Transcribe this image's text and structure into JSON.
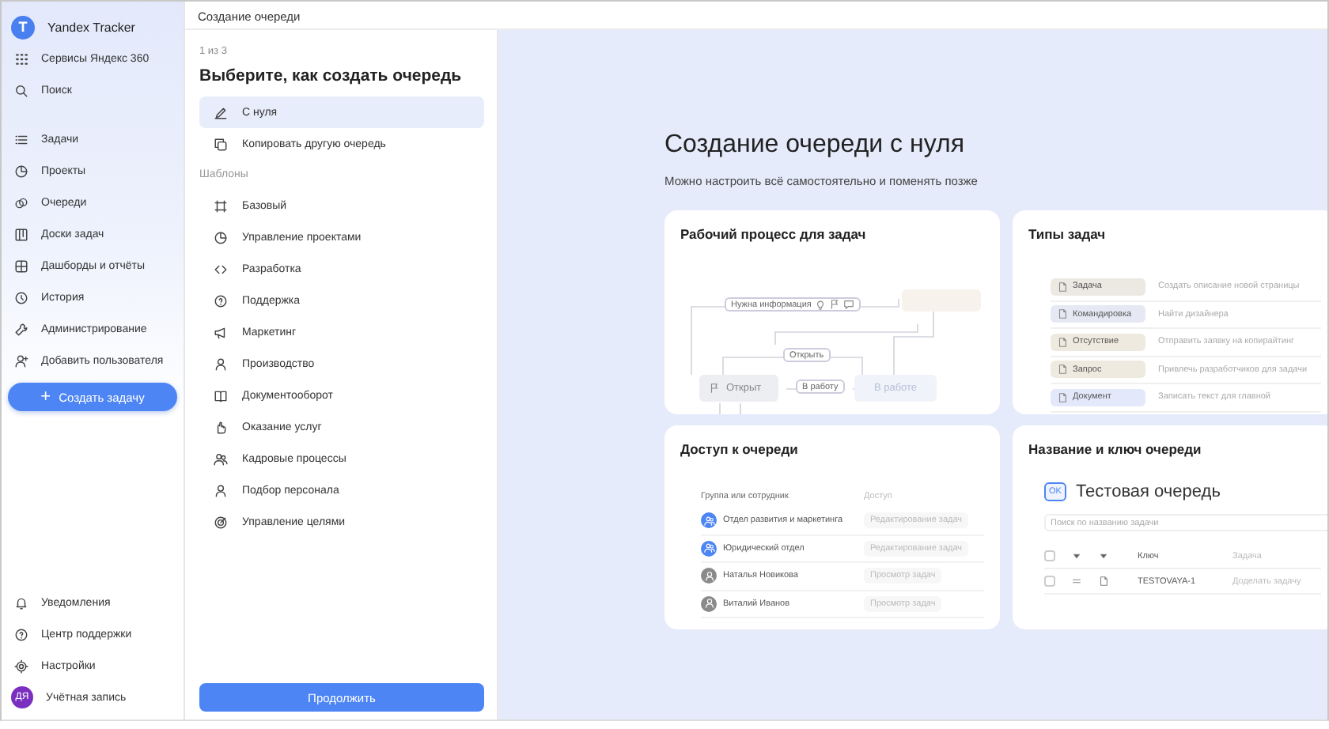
{
  "sidebar": {
    "logo": {
      "letter": "T",
      "title": "Yandex Tracker"
    },
    "top_items": [
      {
        "label": "Сервисы Яндекс 360"
      },
      {
        "label": "Поиск"
      }
    ],
    "nav_items": [
      {
        "label": "Задачи"
      },
      {
        "label": "Проекты"
      },
      {
        "label": "Очереди"
      },
      {
        "label": "Доски задач"
      },
      {
        "label": "Дашборды и отчёты"
      },
      {
        "label": "История"
      },
      {
        "label": "Администрирование"
      },
      {
        "label": "Добавить пользователя"
      }
    ],
    "create_button": {
      "icon_text": "+",
      "label": "Создать задачу"
    },
    "bottom_items": [
      {
        "label": "Уведомления"
      },
      {
        "label": "Центр поддержки"
      },
      {
        "label": "Настройки"
      }
    ],
    "account": {
      "initials": "ДЯ",
      "label": "Учётная запись"
    }
  },
  "header": {
    "title": "Создание очереди"
  },
  "wizard": {
    "step": "1 из 3",
    "title": "Выберите, как создать очередь",
    "options": [
      {
        "label": "С нуля",
        "selected": true
      },
      {
        "label": "Копировать другую очередь",
        "selected": false
      }
    ],
    "templates_label": "Шаблоны",
    "templates": [
      {
        "label": "Базовый",
        "selected": false
      },
      {
        "label": "Управление проектами",
        "selected": false
      },
      {
        "label": "Разработка",
        "selected": false
      },
      {
        "label": "Поддержка",
        "selected": false
      },
      {
        "label": "Маркетинг",
        "selected": false
      },
      {
        "label": "Производство",
        "selected": false
      },
      {
        "label": "Документооборот",
        "selected": false
      },
      {
        "label": "Оказание услуг",
        "selected": false
      },
      {
        "label": "Кадровые процессы",
        "selected": false
      },
      {
        "label": "Подбор персонала",
        "selected": false
      },
      {
        "label": "Управление целями",
        "selected": false
      }
    ],
    "continue_button": "Продолжить"
  },
  "intro": {
    "title": "Создание очереди с нуля",
    "subtitle": "Можно настроить всё самостоятельно и поменять позже"
  },
  "cards": [
    {
      "kind": "workflow",
      "title": "Рабочий процесс для задач",
      "need_info": "Нужна информация",
      "reopen": "Открыть",
      "open_status": "Открыт",
      "to_work": "В работу",
      "in_work": "В работе"
    },
    {
      "kind": "types",
      "title": "Типы задач",
      "rows": [
        {
          "tag": "Задача",
          "color": "#ece9e2",
          "text": "Создать описание новой страницы"
        },
        {
          "tag": "Командировка",
          "color": "#e6e9f3",
          "text": "Найти дизайнера"
        },
        {
          "tag": "Отсутствие",
          "color": "#efeadf",
          "text": "Отправить заявку на копирайтинг"
        },
        {
          "tag": "Запрос",
          "color": "#efeadf",
          "text": "Привлечь разработчиков для задачи"
        },
        {
          "tag": "Документ",
          "color": "#e3e9fb",
          "text": "Записать текст для главной"
        }
      ]
    },
    {
      "kind": "access",
      "title": "Доступ к очереди",
      "columns": [
        "Группа или сотрудник",
        "Доступ"
      ],
      "rows": [
        {
          "kind": "group",
          "name": "Отдел развития и маркетинга",
          "access": "Редактирование задач"
        },
        {
          "kind": "group",
          "name": "Юридический отдел",
          "access": "Редактирование задач"
        },
        {
          "kind": "person",
          "name": "Наталья Новикова",
          "access": "Просмотр задач"
        },
        {
          "kind": "person",
          "name": "Виталий Иванов",
          "access": "Просмотр задач"
        }
      ]
    },
    {
      "kind": "name",
      "title": "Название и ключ очереди",
      "key_badge": "OK",
      "queue_name": "Тестовая очередь",
      "search_placeholder": "Поиск по названию задачи",
      "columns": [
        "Ключ",
        "Задача"
      ],
      "header_checked": false,
      "row": {
        "checked": false,
        "key": "TESTOVAYA-1",
        "task": "Доделать задачу"
      }
    }
  ]
}
